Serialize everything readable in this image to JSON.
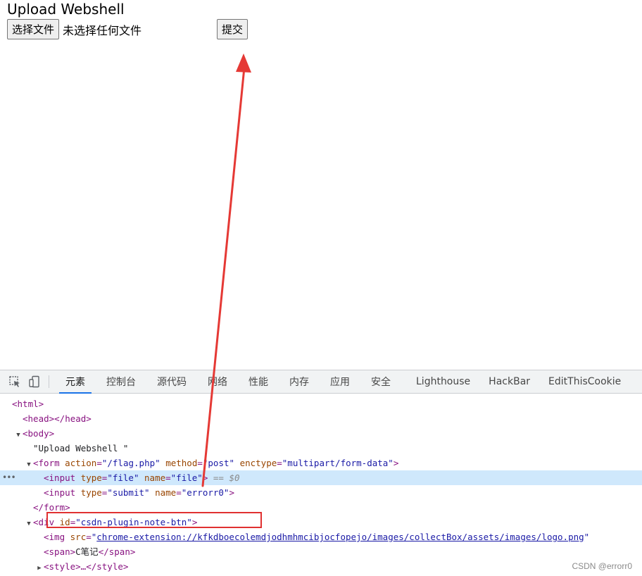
{
  "page": {
    "title": "Upload Webshell",
    "file_button": "选择文件",
    "file_status": "未选择任何文件",
    "submit_button": "提交"
  },
  "devtools": {
    "tabs": [
      "元素",
      "控制台",
      "源代码",
      "网络",
      "性能",
      "内存",
      "应用",
      "安全",
      "Lighthouse",
      "HackBar",
      "EditThisCookie"
    ],
    "active_tab": "元素",
    "dom": {
      "html_open": "<html>",
      "head": "<head></head>",
      "body_open": "<body>",
      "text_node": "\"Upload Webshell \"",
      "form": {
        "tag_open": "<form",
        "action_name": "action",
        "action_value": "\"/flag.php\"",
        "method_name": "method",
        "method_value": "\"post\"",
        "enctype_name": "enctype",
        "enctype_value": "\"multipart/form-data\"",
        "close_bracket": ">"
      },
      "input_file": {
        "tag_open": "<input",
        "type_name": "type",
        "type_value": "\"file\"",
        "name_name": "name",
        "name_value": "\"file\"",
        "close_bracket": ">",
        "ref": "== $0"
      },
      "input_submit": {
        "tag_open": "<input",
        "type_name": "type",
        "type_value": "\"submit\"",
        "name_name": "name",
        "name_value": "\"errorr0\"",
        "close_bracket": ">"
      },
      "form_close": "</form>",
      "div": {
        "tag_open": "<div",
        "id_name": "id",
        "id_value": "\"csdn-plugin-note-btn\"",
        "close_bracket": ">"
      },
      "img": {
        "tag_open": "<img",
        "src_name": "src",
        "src_value": "chrome-extension://kfkdboecolemdjodhmhmcibjocfopejo/images/collectBox/assets/images/logo.png",
        "quote": "\""
      },
      "span": {
        "tag_open": "<span>",
        "text": "C笔记",
        "tag_close": "</span>"
      },
      "style": "<style>…</style>"
    }
  },
  "watermark": "CSDN @errorr0",
  "colors": {
    "annotation_red": "#e03131",
    "selected_row": "#cfe8fc",
    "tab_underline": "#1a73e8"
  }
}
